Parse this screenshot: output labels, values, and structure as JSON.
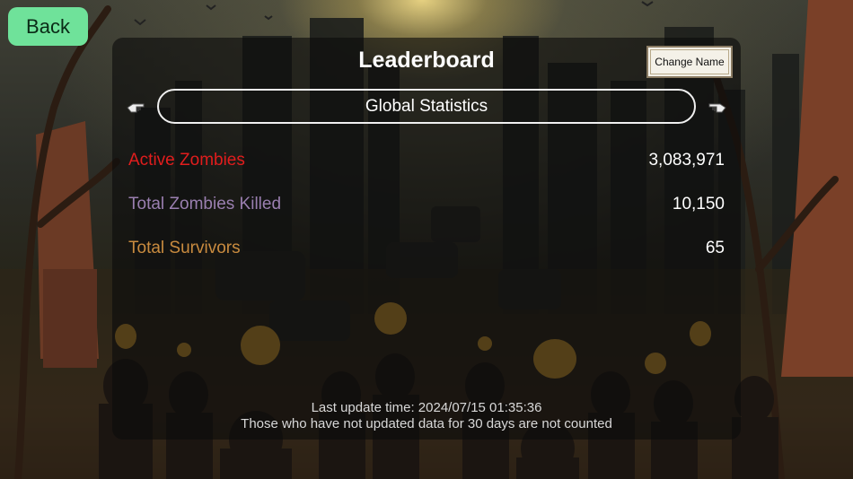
{
  "back_label": "Back",
  "title": "Leaderboard",
  "change_name_label": "Change Name",
  "tab_label": "Global Statistics",
  "stats": [
    {
      "label": "Active Zombies",
      "value": "3,083,971",
      "color": "#e11d1d"
    },
    {
      "label": "Total Zombies Killed",
      "value": "10,150",
      "color": "#9a7fb0"
    },
    {
      "label": "Total Survivors",
      "value": "65",
      "color": "#c98b3f"
    }
  ],
  "footer": {
    "update_time": "Last update time: 2024/07/15 01:35:36",
    "note": "Those who have not updated data for 30 days are not counted"
  },
  "colors": {
    "back_button": "#6fe29a",
    "panel": "#0c0c0c"
  },
  "icons": {
    "prev": "pointing-hand-left-icon",
    "next": "pointing-hand-right-icon"
  }
}
